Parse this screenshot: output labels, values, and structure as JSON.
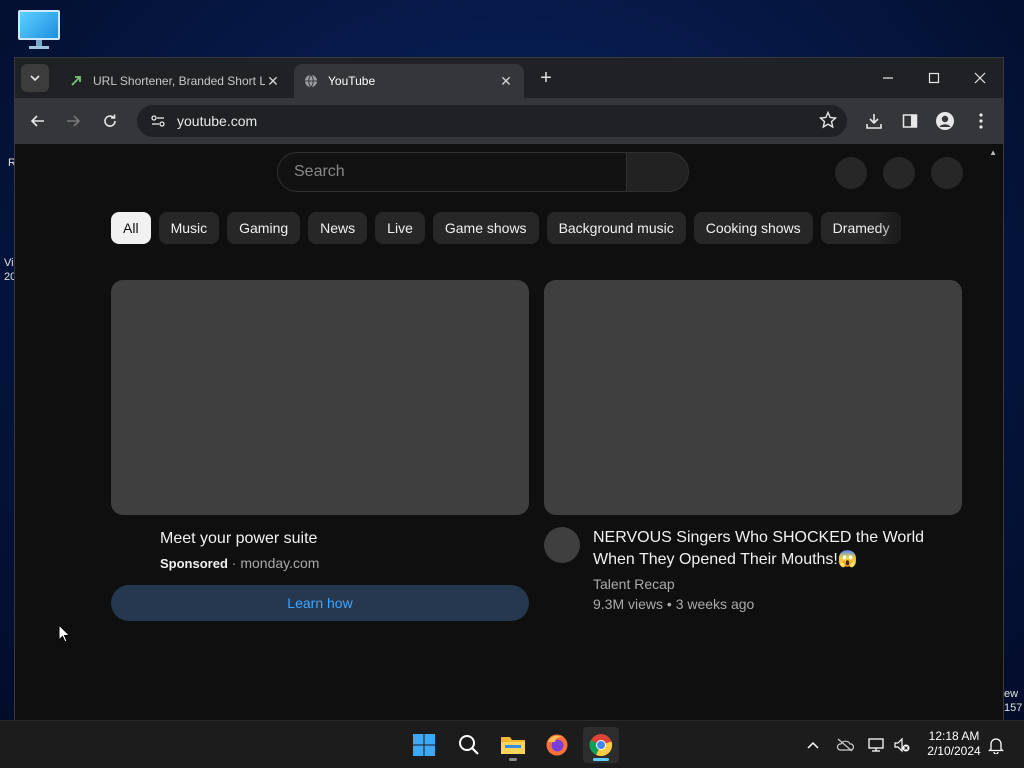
{
  "desktop": {
    "left_fragments": [
      "R",
      "Vi",
      "20"
    ],
    "right_fragments": [
      "ew",
      "157"
    ]
  },
  "browser": {
    "tabs": [
      {
        "title": "URL Shortener, Branded Short L",
        "active": false
      },
      {
        "title": "YouTube",
        "active": true
      }
    ],
    "new_tab_label": "+",
    "address": "youtube.com"
  },
  "youtube": {
    "search_placeholder": "Search",
    "chips": [
      "All",
      "Music",
      "Gaming",
      "News",
      "Live",
      "Game shows",
      "Background music",
      "Cooking shows",
      "Dramedy"
    ],
    "selected_chip": "All",
    "ad": {
      "title": "Meet your power suite",
      "sponsored_label": "Sponsored",
      "separator": " · ",
      "domain": "monday.com",
      "cta_label": "Learn how"
    },
    "video": {
      "title": "NERVOUS Singers Who SHOCKED the World When They Opened Their Mouths!😱",
      "channel": "Talent Recap",
      "stats": "9.3M views • 3 weeks ago"
    }
  },
  "taskbar": {
    "clock_time": "12:18 AM",
    "clock_date": "2/10/2024"
  },
  "colors": {
    "youtube_bg": "#0f0f0f",
    "chip_bg": "#272727",
    "link_blue": "#3ea6ff",
    "learn_btn_bg": "#263850",
    "thumb_placeholder": "#3f3f3f"
  }
}
